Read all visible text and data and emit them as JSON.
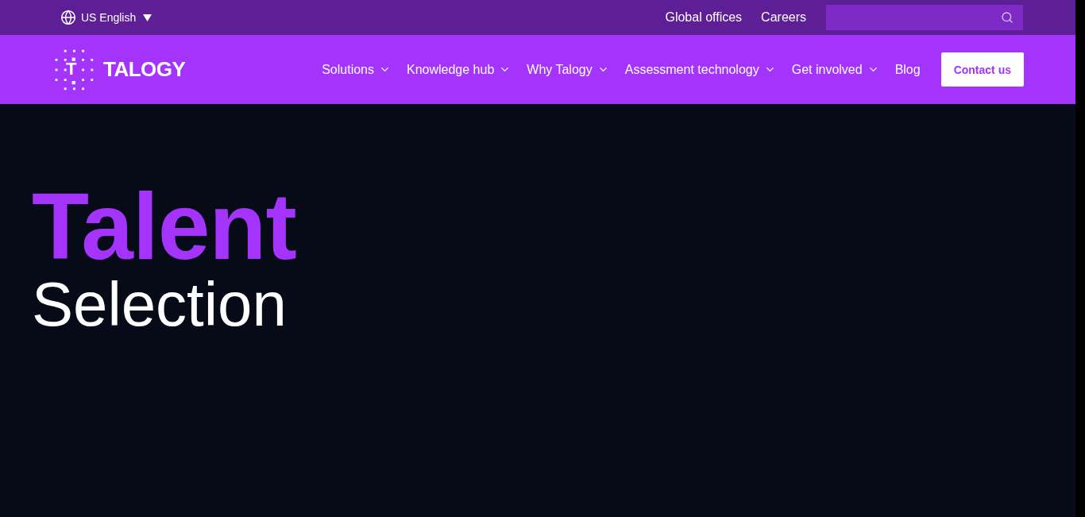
{
  "top_bar": {
    "language": "US English",
    "links": [
      "Global offices",
      "Careers"
    ]
  },
  "header": {
    "logo": {
      "mark": "T",
      "name": "TALOGY"
    },
    "nav": [
      {
        "label": "Solutions",
        "kind": "dropdown"
      },
      {
        "label": "Knowledge hub",
        "kind": "dropdown"
      },
      {
        "label": "Why Talogy",
        "kind": "dropdown"
      },
      {
        "label": "Assessment technology",
        "kind": "dropdown"
      },
      {
        "label": "Get involved",
        "kind": "dropdown"
      },
      {
        "label": "Blog",
        "kind": "link"
      }
    ],
    "cta": "Contact us"
  },
  "hero": {
    "title_line_1": "Talent",
    "title_line_2": "Selection"
  }
}
